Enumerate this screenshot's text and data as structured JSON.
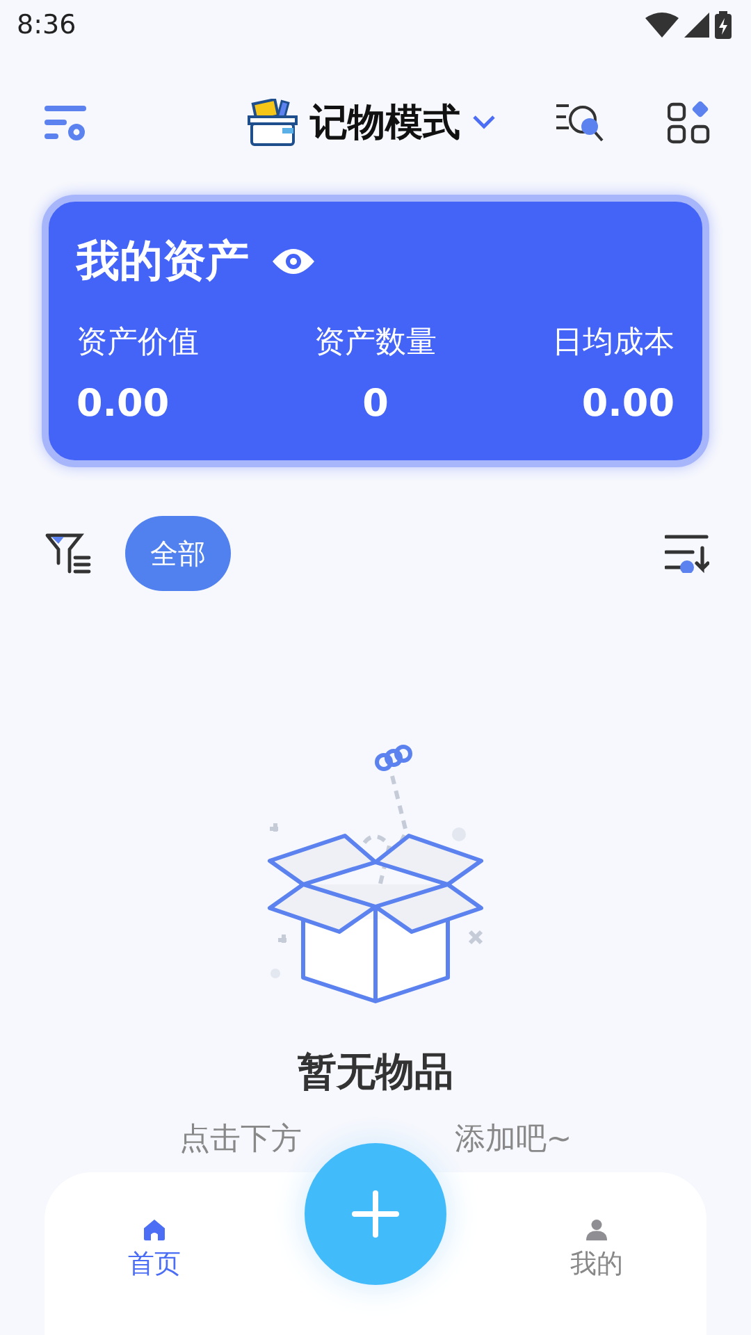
{
  "status_bar": {
    "time": "8:36"
  },
  "header": {
    "mode_title": "记物模式"
  },
  "asset_card": {
    "title": "我的资产",
    "stats": [
      {
        "label": "资产价值",
        "value": "0.00"
      },
      {
        "label": "资产数量",
        "value": "0"
      },
      {
        "label": "日均成本",
        "value": "0.00"
      }
    ]
  },
  "filters": [
    {
      "label": "全部",
      "selected": true
    }
  ],
  "empty_state": {
    "title": "暂无物品",
    "hint_parts": [
      "点击下方",
      "添加吧~"
    ]
  },
  "bottom_nav": [
    {
      "label": "首页",
      "kind": "home",
      "selected": true
    },
    {
      "label": "我的",
      "kind": "profile",
      "selected": false
    }
  ]
}
